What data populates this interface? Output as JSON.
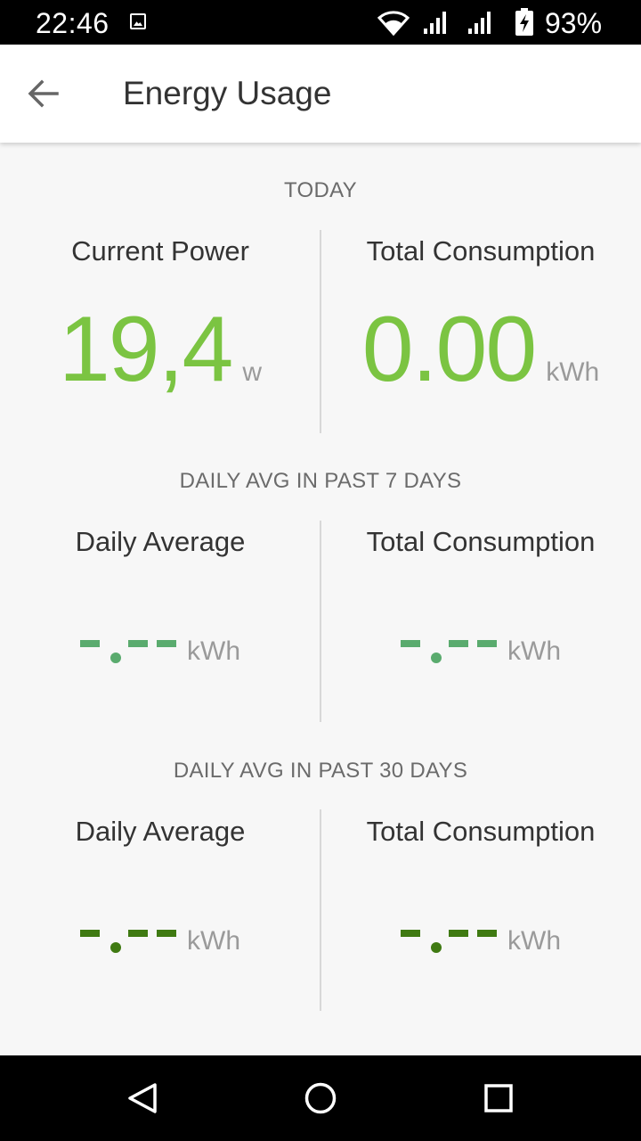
{
  "status_bar": {
    "time": "22:46",
    "battery": "93%",
    "icons": [
      "image-notification-icon",
      "wifi-icon",
      "signal-icon",
      "signal-icon",
      "battery-charging-icon"
    ]
  },
  "app_bar": {
    "title": "Energy Usage",
    "back_icon": "arrow-back-icon"
  },
  "colors": {
    "bright_green": "#7bc442",
    "medium_green": "#5aab6e",
    "dark_green": "#3f7a12"
  },
  "sections": {
    "today": {
      "title": "TODAY",
      "current_power": {
        "label": "Current Power",
        "value": "19,4",
        "unit": "w"
      },
      "total_consumption": {
        "label": "Total Consumption",
        "value": "0.00",
        "unit": "kWh"
      }
    },
    "past_7_days": {
      "title": "DAILY AVG IN PAST 7 DAYS",
      "daily_average": {
        "label": "Daily Average",
        "value": "-.--",
        "unit": "kWh"
      },
      "total_consumption": {
        "label": "Total Consumption",
        "value": "-.--",
        "unit": "kWh"
      }
    },
    "past_30_days": {
      "title": "DAILY AVG IN PAST 30 DAYS",
      "daily_average": {
        "label": "Daily Average",
        "value": "-.--",
        "unit": "kWh"
      },
      "total_consumption": {
        "label": "Total Consumption",
        "value": "-.--",
        "unit": "kWh"
      }
    }
  },
  "nav_bar": {
    "icons": [
      "nav-back-icon",
      "nav-home-icon",
      "nav-recents-icon"
    ]
  }
}
